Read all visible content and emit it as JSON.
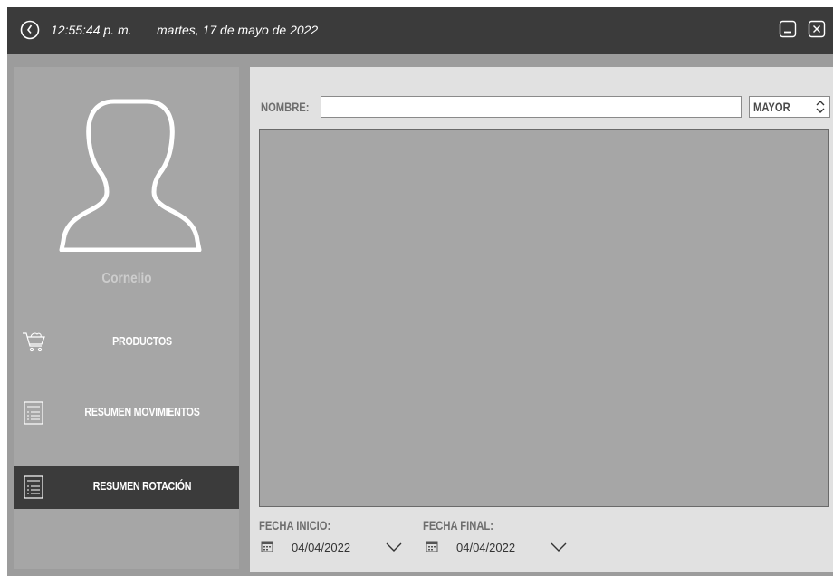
{
  "titlebar": {
    "time": "12:55:44 p. m.",
    "date": "martes, 17 de mayo de 2022",
    "minimize_icon": "minimize-icon",
    "close_icon": "close-icon"
  },
  "sidebar": {
    "username": "Cornelio",
    "avatar_icon": "user-silhouette-icon",
    "items": [
      {
        "label": "PRODUCTOS",
        "icon": "cart-icon",
        "active": false
      },
      {
        "label": "RESUMEN MOVIMIENTOS",
        "icon": "list-document-icon",
        "active": false
      },
      {
        "label": "RESUMEN ROTACIÓN",
        "icon": "list-document-icon",
        "active": true
      }
    ]
  },
  "main": {
    "name_label": "NOMBRE:",
    "name_value": "",
    "sort_value": "MAYOR",
    "start_label": "FECHA INICIO:",
    "start_date": "04/04/2022",
    "end_label": "FECHA FINAL:",
    "end_date": "04/04/2022"
  },
  "colors": {
    "titlebar_bg": "#3b3b3b",
    "sidebar_bg": "#a6a6a6",
    "active_item_bg": "#3b3b3b",
    "main_bg": "#e1e1e1",
    "grid_bg": "#a6a6a6"
  }
}
